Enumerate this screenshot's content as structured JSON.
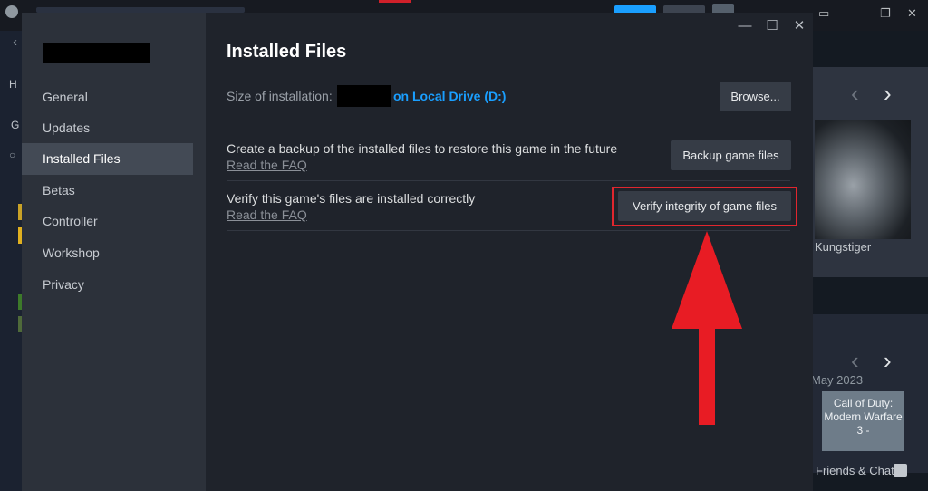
{
  "dialog": {
    "page_title": "Installed Files",
    "nav_items": [
      {
        "label": "General"
      },
      {
        "label": "Updates"
      },
      {
        "label": "Installed Files",
        "active": true
      },
      {
        "label": "Betas"
      },
      {
        "label": "Controller"
      },
      {
        "label": "Workshop"
      },
      {
        "label": "Privacy"
      }
    ],
    "size_label": "Size of installation:",
    "size_location": "on Local Drive (D:)",
    "browse_label": "Browse...",
    "backup": {
      "text": "Create a backup of the installed files to restore this game in the future",
      "link": "Read the FAQ",
      "button": "Backup game files"
    },
    "verify": {
      "text": "Verify this game's files are installed correctly",
      "link": "Read the FAQ",
      "button": "Verify integrity of game files"
    },
    "window_controls": {
      "minimize": "—",
      "maximize": "☐",
      "close": "✕"
    }
  },
  "background": {
    "left_stubs": [
      "H",
      "G"
    ],
    "featured_caption": "Kungstiger",
    "date_text": "May 2023",
    "card_text": "Call of Duty: Modern Warfare 3 -",
    "friends_label": "Friends & Chat",
    "arrow_prev": "‹",
    "arrow_next": "›"
  },
  "colors": {
    "accent_blue": "#1a9fff",
    "highlight_red": "#e0262e",
    "arrow_red": "#e81c24",
    "dialog_bg": "#1f232b",
    "sidebar_bg": "#2c313a"
  }
}
